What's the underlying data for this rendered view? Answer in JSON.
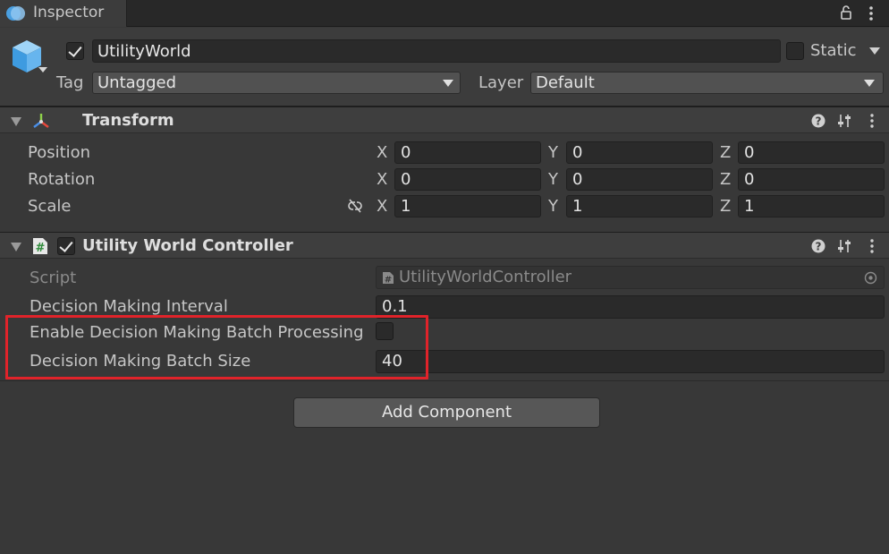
{
  "tab": {
    "title": "Inspector"
  },
  "gameobject": {
    "name": "UtilityWorld",
    "static_label": "Static",
    "tag_label": "Tag",
    "tag_value": "Untagged",
    "layer_label": "Layer",
    "layer_value": "Default"
  },
  "transform": {
    "title": "Transform",
    "rows": [
      {
        "label": "Position",
        "x": "0",
        "y": "0",
        "z": "0"
      },
      {
        "label": "Rotation",
        "x": "0",
        "y": "0",
        "z": "0"
      },
      {
        "label": "Scale",
        "x": "1",
        "y": "1",
        "z": "1"
      }
    ],
    "axes": {
      "x": "X",
      "y": "Y",
      "z": "Z"
    }
  },
  "uwc": {
    "title": "Utility World Controller",
    "script_label": "Script",
    "script_value": "UtilityWorldController",
    "interval_label": "Decision Making Interval",
    "interval_value": "0.1",
    "batch_enable_label": "Enable Decision Making Batch Processing",
    "batch_size_label": "Decision Making Batch Size",
    "batch_size_value": "40"
  },
  "add_component_label": "Add Component",
  "colors": {
    "highlight": "#e0232a",
    "transform_x": "#e8483c",
    "transform_y": "#8fd24a",
    "transform_z": "#4a8fe8"
  }
}
